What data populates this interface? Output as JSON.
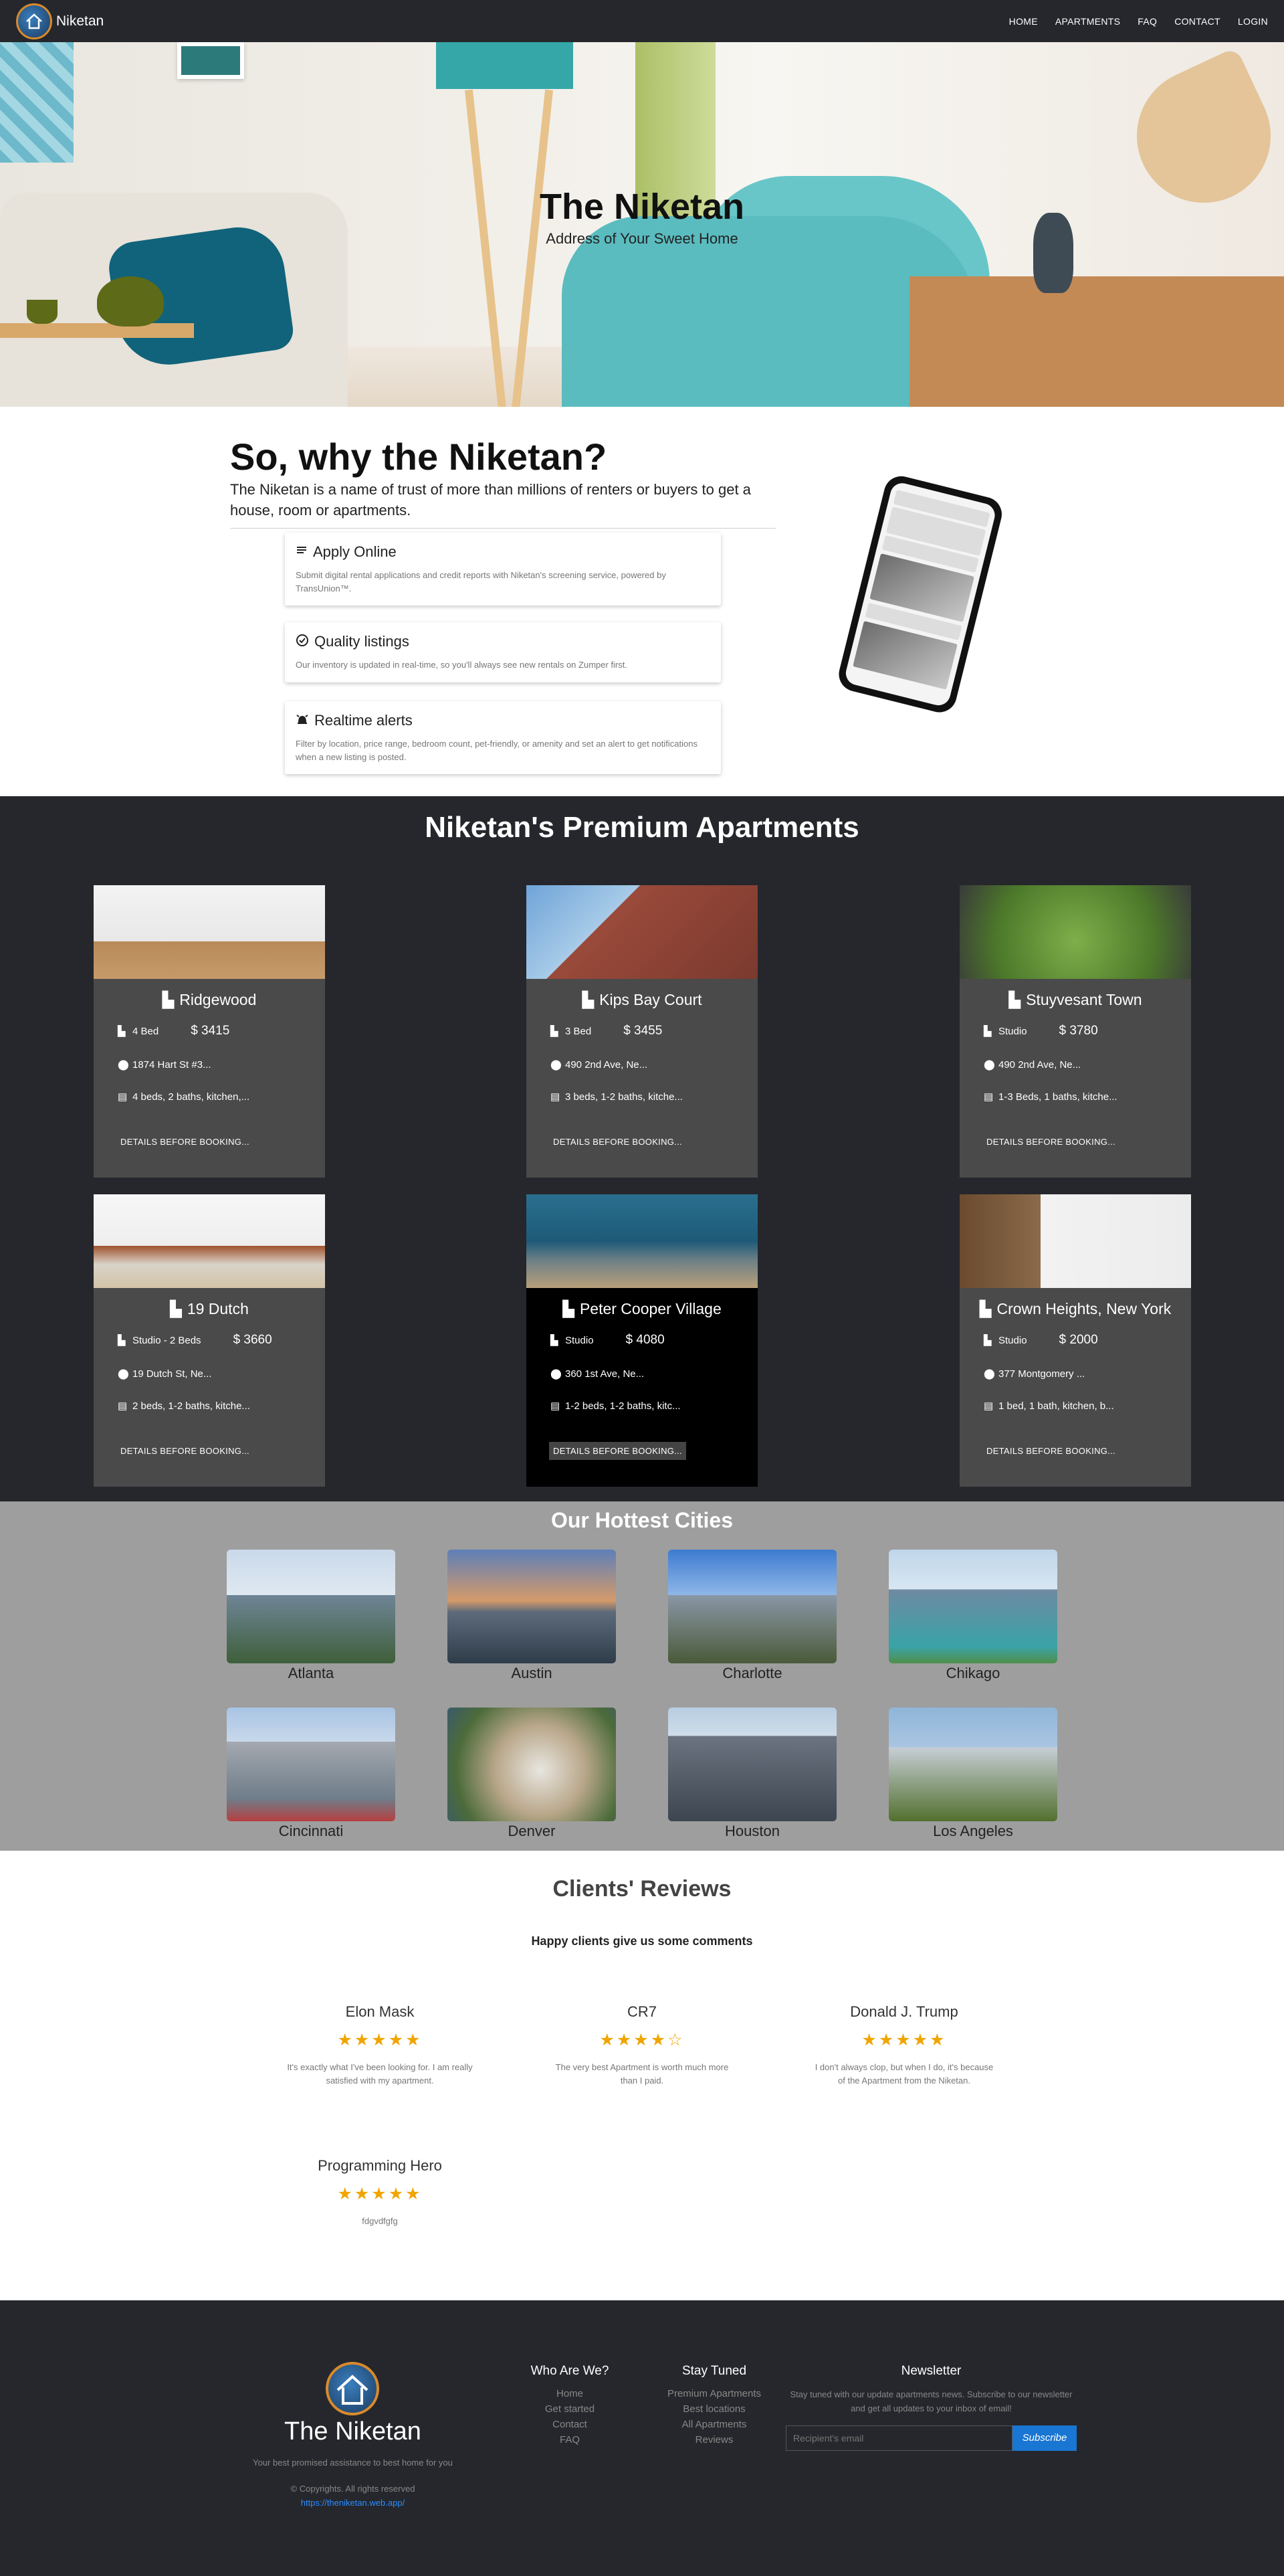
{
  "nav": {
    "brand": "Niketan",
    "links": [
      "HOME",
      "APARTMENTS",
      "FAQ",
      "CONTACT",
      "LOGIN"
    ]
  },
  "hero": {
    "title": "The Niketan",
    "subtitle": "Address of Your Sweet Home"
  },
  "why": {
    "title": "So, why the Niketan?",
    "description": "The Niketan is a name of trust of more than millions of renters or buyers to get a house, room or apartments.",
    "features": [
      {
        "title": "Apply Online",
        "description": "Submit digital rental applications and credit reports with Niketan's screening service, powered by TransUnion™.",
        "icon": "list-icon"
      },
      {
        "title": "Quality listings",
        "description": "Our inventory is updated in real-time, so you'll always see new rentals on Zumper first.",
        "icon": "check-circle-icon"
      },
      {
        "title": "Realtime alerts",
        "description": "Filter by location, price range, bedroom count, pet-friendly, or amenity and set an alert to get notifications when a new listing is posted.",
        "icon": "alarm-icon"
      }
    ]
  },
  "apartments": {
    "title": "Niketan's Premium Apartments",
    "button_label": "DETAILS BEFORE BOOKING...",
    "items": [
      {
        "name": "Ridgewood",
        "beds": "4 Bed",
        "price": "$ 3415",
        "address": "1874 Hart St #3...",
        "details": "4 beds, 2 baths, kitchen,..."
      },
      {
        "name": "Kips Bay Court",
        "beds": "3 Bed",
        "price": "$ 3455",
        "address": "490 2nd Ave, Ne...",
        "details": "3 beds, 1-2 baths, kitche..."
      },
      {
        "name": "Stuyvesant Town",
        "beds": "Studio",
        "price": "$ 3780",
        "address": "490 2nd Ave, Ne...",
        "details": "1-3 Beds, 1 baths, kitche..."
      },
      {
        "name": "19 Dutch",
        "beds": "Studio - 2 Beds",
        "price": "$ 3660",
        "address": "19 Dutch St, Ne...",
        "details": "2 beds, 1-2 baths, kitche..."
      },
      {
        "name": "Peter Cooper Village",
        "beds": "Studio",
        "price": "$ 4080",
        "address": "360 1st Ave, Ne...",
        "details": "1-2 beds, 1-2 baths, kitc..."
      },
      {
        "name": "Crown Heights, New York",
        "beds": "Studio",
        "price": "$ 2000",
        "address": "377 Montgomery ...",
        "details": "1 bed, 1 bath, kitchen, b..."
      }
    ]
  },
  "cities": {
    "title": "Our Hottest Cities",
    "items": [
      "Atlanta",
      "Austin",
      "Charlotte",
      "Chikago",
      "Cincinnati",
      "Denver",
      "Houston",
      "Los Angeles"
    ]
  },
  "reviews": {
    "title": "Clients' Reviews",
    "subtitle": "Happy clients give us some comments",
    "items": [
      {
        "name": "Elon Mask",
        "stars": "★★★★★",
        "rating": 5,
        "text": "It's exactly what I've been looking for. I am really satisfied with my apartment."
      },
      {
        "name": "CR7",
        "stars": "★★★★☆",
        "rating": 4,
        "text": "The very best Apartment is worth much more than I paid."
      },
      {
        "name": "Donald J. Trump",
        "stars": "★★★★★",
        "rating": 5,
        "text": "I don't always clop, but when I do, it's because of the Apartment from the Niketan."
      },
      {
        "name": "Programming Hero",
        "stars": "★★★★★",
        "rating": 5,
        "text": "fdgvdfgfg"
      }
    ]
  },
  "footer": {
    "brand": "The Niketan",
    "tagline": "Your best promised assistance to best home for you",
    "copyright": "© Copyrights. All rights reserved",
    "url": "https://theniketan.web.app/",
    "who": {
      "title": "Who Are We?",
      "links": [
        "Home",
        "Get started",
        "Contact",
        "FAQ"
      ]
    },
    "stay": {
      "title": "Stay Tuned",
      "links": [
        "Premium Apartments",
        "Best locations",
        "All Apartments",
        "Reviews"
      ]
    },
    "newsletter": {
      "title": "Newsletter",
      "text": "Stay tuned with our update apartments news. Subscribe to our newsletter and get all updates to your inbox of email!",
      "placeholder": "Recipient's email",
      "button": "Subscribe"
    }
  }
}
